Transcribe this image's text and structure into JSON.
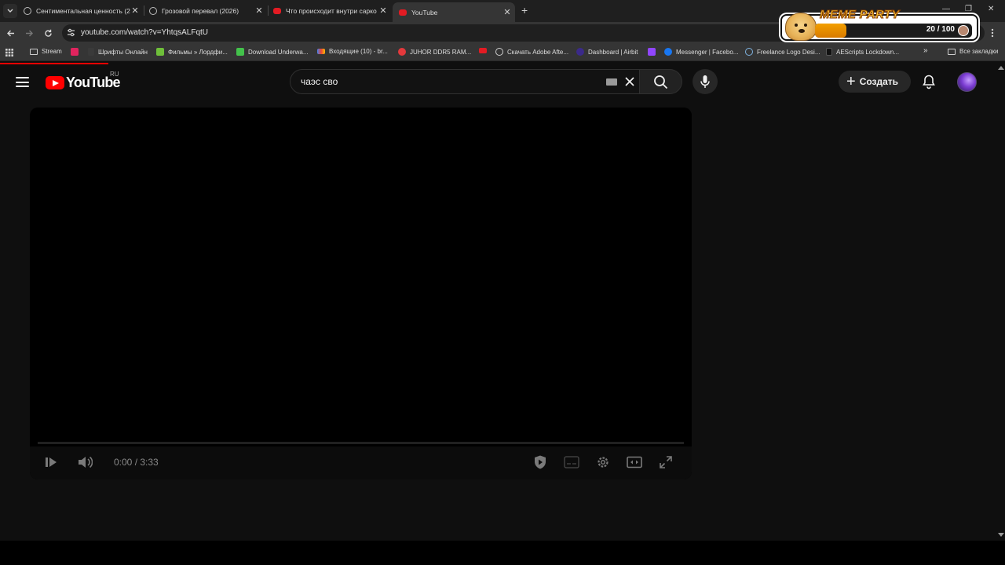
{
  "browser": {
    "tabs": [
      {
        "title": "Сентиментальная ценность (2",
        "icon": "globe-icon"
      },
      {
        "title": "Грозовой перевал (2026)",
        "icon": "globe-icon"
      },
      {
        "title": "Что происходит внутри сарко",
        "icon": "youtube-icon"
      },
      {
        "title": "YouTube",
        "icon": "youtube-icon",
        "active": true
      }
    ],
    "url": "youtube.com/watch?v=YhtqsALFqtU",
    "bookmarks": [
      {
        "label": "Stream",
        "icon": "folder-icon"
      },
      {
        "label": "",
        "icon": "live-icon"
      },
      {
        "label": "Шрифты Онлайн",
        "icon": "font-icon"
      },
      {
        "label": "Фильмы » Лордфи...",
        "icon": "film-icon"
      },
      {
        "label": "Download Underwa...",
        "icon": "download-icon"
      },
      {
        "label": "Входящие (10) - br...",
        "icon": "gmail-icon"
      },
      {
        "label": "JUHOR DDR5 RAM...",
        "icon": "aliexpress-icon"
      },
      {
        "label": "",
        "icon": "youtube-icon"
      },
      {
        "label": "Скачать Adobe Afte...",
        "icon": "globe-icon"
      },
      {
        "label": "Dashboard | Airbit",
        "icon": "airbit-icon"
      },
      {
        "label": "",
        "icon": "twitch-icon"
      },
      {
        "label": "Messenger | Facebo...",
        "icon": "facebook-icon"
      },
      {
        "label": "Freelance Logo Desi...",
        "icon": "freelance-icon"
      },
      {
        "label": "AEScripts Lockdown...",
        "icon": "tiktok-icon"
      }
    ],
    "bookmarks_more": "»",
    "all_bookmarks": "Все закладки"
  },
  "overlay": {
    "title": "MEME PARTY",
    "count": "20 / 100",
    "progress": 0.2
  },
  "youtube": {
    "logo_text": "YouTube",
    "region": "RU",
    "search_query": "чаэс сво",
    "create_label": "Создать"
  },
  "player": {
    "time": "0:00 / 3:33"
  },
  "colors": {
    "youtube_red": "#ff0000",
    "background": "#0f0f0f",
    "overlay_orange": "#f3a000"
  }
}
